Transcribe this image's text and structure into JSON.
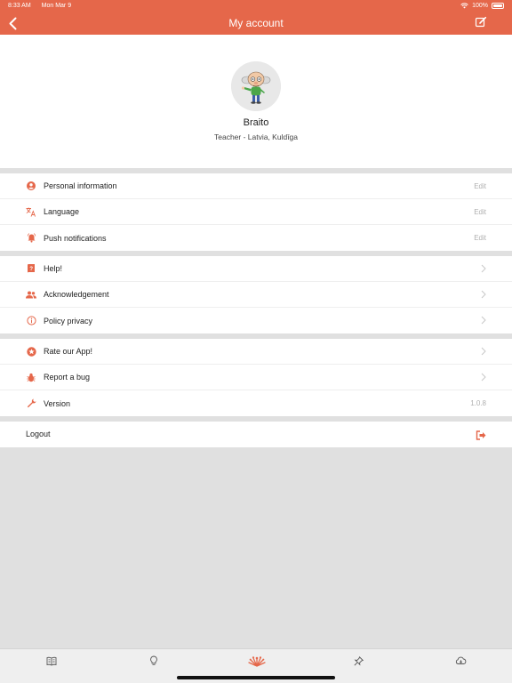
{
  "status": {
    "time": "8:33 AM",
    "date": "Mon Mar 9",
    "battery": "100%"
  },
  "nav": {
    "title": "My account"
  },
  "profile": {
    "name": "Braito",
    "subtitle": "Teacher - Latvia, Kuldīga"
  },
  "colors": {
    "accent": "#e5674a",
    "muted": "#b0b0b0",
    "background": "#e0e0e0"
  },
  "sections": [
    {
      "items": [
        {
          "icon": "account-circle-icon",
          "label": "Personal information",
          "right": "Edit"
        },
        {
          "icon": "translate-icon",
          "label": "Language",
          "right": "Edit"
        },
        {
          "icon": "notification-bell-icon",
          "label": "Push notifications",
          "right": "Edit"
        }
      ]
    },
    {
      "items": [
        {
          "icon": "help-icon",
          "label": "Help!"
        },
        {
          "icon": "people-icon",
          "label": "Acknowledgement"
        },
        {
          "icon": "info-icon",
          "label": "Policy privacy"
        }
      ]
    },
    {
      "items": [
        {
          "icon": "star-icon",
          "label": "Rate our App!"
        },
        {
          "icon": "bug-icon",
          "label": "Report a bug"
        },
        {
          "icon": "wrench-icon",
          "label": "Version",
          "right": "1.0.8"
        }
      ]
    }
  ],
  "logout": {
    "label": "Logout",
    "icon": "logout-icon"
  },
  "tabs": [
    {
      "icon": "book-icon"
    },
    {
      "icon": "lightbulb-icon"
    },
    {
      "icon": "logo-icon"
    },
    {
      "icon": "pin-icon"
    },
    {
      "icon": "cloud-download-icon"
    }
  ]
}
